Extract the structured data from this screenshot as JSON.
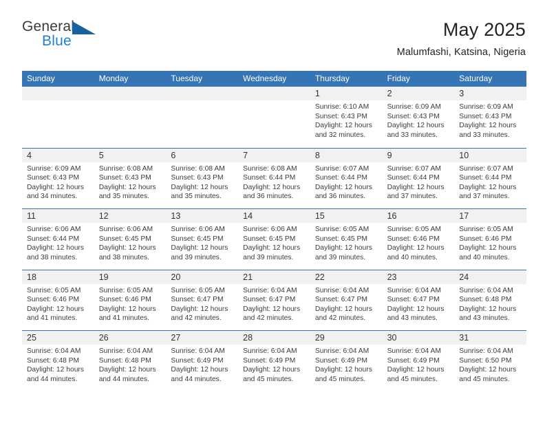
{
  "brand": {
    "name_part1": "General",
    "name_part2": "Blue",
    "triangle_color": "#17629f",
    "blue_color": "#1f7fd0"
  },
  "header": {
    "title": "May 2025",
    "subtitle": "Malumfashi, Katsina, Nigeria"
  },
  "theme": {
    "header_blue": "#3575b5",
    "number_strip": "#f1f1f1",
    "text": "#3c3c3c"
  },
  "weekdays": [
    "Sunday",
    "Monday",
    "Tuesday",
    "Wednesday",
    "Thursday",
    "Friday",
    "Saturday"
  ],
  "weeks": [
    [
      {
        "empty": true
      },
      {
        "empty": true
      },
      {
        "empty": true
      },
      {
        "empty": true
      },
      {
        "day": "1",
        "sunrise": "Sunrise: 6:10 AM",
        "sunset": "Sunset: 6:43 PM",
        "daylight1": "Daylight: 12 hours",
        "daylight2": "and 32 minutes."
      },
      {
        "day": "2",
        "sunrise": "Sunrise: 6:09 AM",
        "sunset": "Sunset: 6:43 PM",
        "daylight1": "Daylight: 12 hours",
        "daylight2": "and 33 minutes."
      },
      {
        "day": "3",
        "sunrise": "Sunrise: 6:09 AM",
        "sunset": "Sunset: 6:43 PM",
        "daylight1": "Daylight: 12 hours",
        "daylight2": "and 33 minutes."
      }
    ],
    [
      {
        "day": "4",
        "sunrise": "Sunrise: 6:09 AM",
        "sunset": "Sunset: 6:43 PM",
        "daylight1": "Daylight: 12 hours",
        "daylight2": "and 34 minutes."
      },
      {
        "day": "5",
        "sunrise": "Sunrise: 6:08 AM",
        "sunset": "Sunset: 6:43 PM",
        "daylight1": "Daylight: 12 hours",
        "daylight2": "and 35 minutes."
      },
      {
        "day": "6",
        "sunrise": "Sunrise: 6:08 AM",
        "sunset": "Sunset: 6:43 PM",
        "daylight1": "Daylight: 12 hours",
        "daylight2": "and 35 minutes."
      },
      {
        "day": "7",
        "sunrise": "Sunrise: 6:08 AM",
        "sunset": "Sunset: 6:44 PM",
        "daylight1": "Daylight: 12 hours",
        "daylight2": "and 36 minutes."
      },
      {
        "day": "8",
        "sunrise": "Sunrise: 6:07 AM",
        "sunset": "Sunset: 6:44 PM",
        "daylight1": "Daylight: 12 hours",
        "daylight2": "and 36 minutes."
      },
      {
        "day": "9",
        "sunrise": "Sunrise: 6:07 AM",
        "sunset": "Sunset: 6:44 PM",
        "daylight1": "Daylight: 12 hours",
        "daylight2": "and 37 minutes."
      },
      {
        "day": "10",
        "sunrise": "Sunrise: 6:07 AM",
        "sunset": "Sunset: 6:44 PM",
        "daylight1": "Daylight: 12 hours",
        "daylight2": "and 37 minutes."
      }
    ],
    [
      {
        "day": "11",
        "sunrise": "Sunrise: 6:06 AM",
        "sunset": "Sunset: 6:44 PM",
        "daylight1": "Daylight: 12 hours",
        "daylight2": "and 38 minutes."
      },
      {
        "day": "12",
        "sunrise": "Sunrise: 6:06 AM",
        "sunset": "Sunset: 6:45 PM",
        "daylight1": "Daylight: 12 hours",
        "daylight2": "and 38 minutes."
      },
      {
        "day": "13",
        "sunrise": "Sunrise: 6:06 AM",
        "sunset": "Sunset: 6:45 PM",
        "daylight1": "Daylight: 12 hours",
        "daylight2": "and 39 minutes."
      },
      {
        "day": "14",
        "sunrise": "Sunrise: 6:06 AM",
        "sunset": "Sunset: 6:45 PM",
        "daylight1": "Daylight: 12 hours",
        "daylight2": "and 39 minutes."
      },
      {
        "day": "15",
        "sunrise": "Sunrise: 6:05 AM",
        "sunset": "Sunset: 6:45 PM",
        "daylight1": "Daylight: 12 hours",
        "daylight2": "and 39 minutes."
      },
      {
        "day": "16",
        "sunrise": "Sunrise: 6:05 AM",
        "sunset": "Sunset: 6:46 PM",
        "daylight1": "Daylight: 12 hours",
        "daylight2": "and 40 minutes."
      },
      {
        "day": "17",
        "sunrise": "Sunrise: 6:05 AM",
        "sunset": "Sunset: 6:46 PM",
        "daylight1": "Daylight: 12 hours",
        "daylight2": "and 40 minutes."
      }
    ],
    [
      {
        "day": "18",
        "sunrise": "Sunrise: 6:05 AM",
        "sunset": "Sunset: 6:46 PM",
        "daylight1": "Daylight: 12 hours",
        "daylight2": "and 41 minutes."
      },
      {
        "day": "19",
        "sunrise": "Sunrise: 6:05 AM",
        "sunset": "Sunset: 6:46 PM",
        "daylight1": "Daylight: 12 hours",
        "daylight2": "and 41 minutes."
      },
      {
        "day": "20",
        "sunrise": "Sunrise: 6:05 AM",
        "sunset": "Sunset: 6:47 PM",
        "daylight1": "Daylight: 12 hours",
        "daylight2": "and 42 minutes."
      },
      {
        "day": "21",
        "sunrise": "Sunrise: 6:04 AM",
        "sunset": "Sunset: 6:47 PM",
        "daylight1": "Daylight: 12 hours",
        "daylight2": "and 42 minutes."
      },
      {
        "day": "22",
        "sunrise": "Sunrise: 6:04 AM",
        "sunset": "Sunset: 6:47 PM",
        "daylight1": "Daylight: 12 hours",
        "daylight2": "and 42 minutes."
      },
      {
        "day": "23",
        "sunrise": "Sunrise: 6:04 AM",
        "sunset": "Sunset: 6:47 PM",
        "daylight1": "Daylight: 12 hours",
        "daylight2": "and 43 minutes."
      },
      {
        "day": "24",
        "sunrise": "Sunrise: 6:04 AM",
        "sunset": "Sunset: 6:48 PM",
        "daylight1": "Daylight: 12 hours",
        "daylight2": "and 43 minutes."
      }
    ],
    [
      {
        "day": "25",
        "sunrise": "Sunrise: 6:04 AM",
        "sunset": "Sunset: 6:48 PM",
        "daylight1": "Daylight: 12 hours",
        "daylight2": "and 44 minutes."
      },
      {
        "day": "26",
        "sunrise": "Sunrise: 6:04 AM",
        "sunset": "Sunset: 6:48 PM",
        "daylight1": "Daylight: 12 hours",
        "daylight2": "and 44 minutes."
      },
      {
        "day": "27",
        "sunrise": "Sunrise: 6:04 AM",
        "sunset": "Sunset: 6:49 PM",
        "daylight1": "Daylight: 12 hours",
        "daylight2": "and 44 minutes."
      },
      {
        "day": "28",
        "sunrise": "Sunrise: 6:04 AM",
        "sunset": "Sunset: 6:49 PM",
        "daylight1": "Daylight: 12 hours",
        "daylight2": "and 45 minutes."
      },
      {
        "day": "29",
        "sunrise": "Sunrise: 6:04 AM",
        "sunset": "Sunset: 6:49 PM",
        "daylight1": "Daylight: 12 hours",
        "daylight2": "and 45 minutes."
      },
      {
        "day": "30",
        "sunrise": "Sunrise: 6:04 AM",
        "sunset": "Sunset: 6:49 PM",
        "daylight1": "Daylight: 12 hours",
        "daylight2": "and 45 minutes."
      },
      {
        "day": "31",
        "sunrise": "Sunrise: 6:04 AM",
        "sunset": "Sunset: 6:50 PM",
        "daylight1": "Daylight: 12 hours",
        "daylight2": "and 45 minutes."
      }
    ]
  ]
}
